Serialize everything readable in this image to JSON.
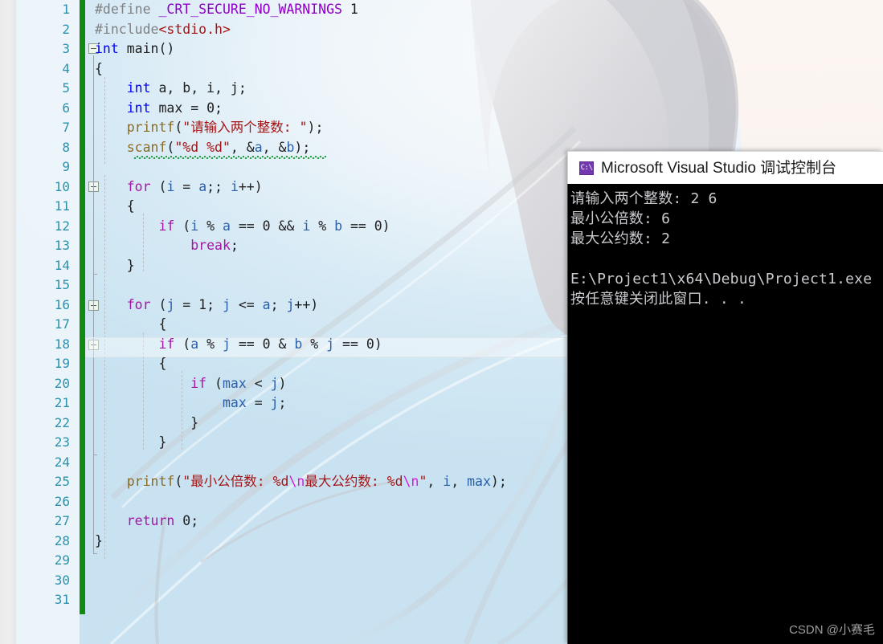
{
  "editor": {
    "name": "visual-studio-code-editor",
    "line_numbers": [
      1,
      2,
      3,
      4,
      5,
      6,
      7,
      8,
      9,
      10,
      11,
      12,
      13,
      14,
      15,
      16,
      17,
      18,
      19,
      20,
      21,
      22,
      23,
      24,
      25,
      26,
      27,
      28,
      29,
      30,
      31
    ],
    "current_line": 18,
    "change_bar_color": "#108a10",
    "gutter_number_color": "#2b91af",
    "lines": [
      {
        "n": 1,
        "text": "#define _CRT_SECURE_NO_WARNINGS 1"
      },
      {
        "n": 2,
        "text": "#include<stdio.h>"
      },
      {
        "n": 3,
        "text": "int main()"
      },
      {
        "n": 4,
        "text": "{"
      },
      {
        "n": 5,
        "text": "    int a, b, i, j;"
      },
      {
        "n": 6,
        "text": "    int max = 0;"
      },
      {
        "n": 7,
        "text": "    printf(\"请输入两个整数: \");"
      },
      {
        "n": 8,
        "text": "    scanf(\"%d %d\", &a, &b);"
      },
      {
        "n": 9,
        "text": ""
      },
      {
        "n": 10,
        "text": "    for (i = a;; i++)"
      },
      {
        "n": 11,
        "text": "    {"
      },
      {
        "n": 12,
        "text": "        if (i % a == 0 && i % b == 0)"
      },
      {
        "n": 13,
        "text": "            break;"
      },
      {
        "n": 14,
        "text": "    }"
      },
      {
        "n": 15,
        "text": ""
      },
      {
        "n": 16,
        "text": "    for (j = 1; j <= a; j++)"
      },
      {
        "n": 17,
        "text": "    {"
      },
      {
        "n": 18,
        "text": "        if (a % j == 0 & b % j == 0)"
      },
      {
        "n": 19,
        "text": "        {"
      },
      {
        "n": 20,
        "text": "            if (max < j)"
      },
      {
        "n": 21,
        "text": "                max = j;"
      },
      {
        "n": 22,
        "text": "        }"
      },
      {
        "n": 23,
        "text": "    }"
      },
      {
        "n": 24,
        "text": ""
      },
      {
        "n": 25,
        "text": "    printf(\"最小公倍数: %d\\n最大公约数: %d\\n\", i, max);"
      },
      {
        "n": 26,
        "text": ""
      },
      {
        "n": 27,
        "text": "    return 0;"
      },
      {
        "n": 28,
        "text": "}"
      },
      {
        "n": 29,
        "text": ""
      },
      {
        "n": 30,
        "text": ""
      },
      {
        "n": 31,
        "text": ""
      }
    ],
    "tokens": {
      "l1": [
        [
          "#define ",
          "t-pre"
        ],
        [
          "_CRT_SECURE_NO_WARNINGS",
          "t-macro"
        ],
        [
          " ",
          "t-plain"
        ],
        [
          "1",
          "t-num"
        ]
      ],
      "l2": [
        [
          "#include",
          "t-pre"
        ],
        [
          "<stdio.h>",
          "t-hdr"
        ]
      ],
      "l3": [
        [
          "int",
          "t-kw"
        ],
        [
          " main()",
          "t-plain"
        ]
      ],
      "l4": [
        [
          "{",
          "t-brace"
        ]
      ],
      "l5": [
        [
          "    ",
          "t-plain"
        ],
        [
          "int",
          "t-kw"
        ],
        [
          " a, b, i, j;",
          "t-plain"
        ]
      ],
      "l6": [
        [
          "    ",
          "t-plain"
        ],
        [
          "int",
          "t-kw"
        ],
        [
          " max = 0;",
          "t-plain"
        ]
      ],
      "l7": [
        [
          "    ",
          "t-plain"
        ],
        [
          "printf",
          "t-fn"
        ],
        [
          "(",
          "t-plain"
        ],
        [
          "\"请输入两个整数: \"",
          "t-str"
        ],
        [
          ");",
          "t-plain"
        ]
      ],
      "l8": [
        [
          "    ",
          "t-plain"
        ],
        [
          "scanf",
          "t-fn"
        ],
        [
          "(",
          "t-plain"
        ],
        [
          "\"%d %d\"",
          "t-str"
        ],
        [
          ", &",
          "t-plain"
        ],
        [
          "a",
          "t-id"
        ],
        [
          ", &",
          "t-plain"
        ],
        [
          "b",
          "t-id"
        ],
        [
          ");",
          "t-plain"
        ]
      ],
      "l10": [
        [
          "    ",
          "t-plain"
        ],
        [
          "for",
          "t-ctl"
        ],
        [
          " (",
          "t-plain"
        ],
        [
          "i",
          "t-id"
        ],
        [
          " = ",
          "t-plain"
        ],
        [
          "a",
          "t-id"
        ],
        [
          ";; ",
          "t-plain"
        ],
        [
          "i",
          "t-id"
        ],
        [
          "++)",
          "t-plain"
        ]
      ],
      "l11": [
        [
          "    {",
          "t-brace"
        ]
      ],
      "l12": [
        [
          "        ",
          "t-plain"
        ],
        [
          "if",
          "t-ctl"
        ],
        [
          " (",
          "t-plain"
        ],
        [
          "i",
          "t-id"
        ],
        [
          " % ",
          "t-plain"
        ],
        [
          "a",
          "t-id"
        ],
        [
          " == 0 && ",
          "t-plain"
        ],
        [
          "i",
          "t-id"
        ],
        [
          " % ",
          "t-plain"
        ],
        [
          "b",
          "t-id"
        ],
        [
          " == 0)",
          "t-plain"
        ]
      ],
      "l13": [
        [
          "            ",
          "t-plain"
        ],
        [
          "break",
          "t-ctl"
        ],
        [
          ";",
          "t-plain"
        ]
      ],
      "l14": [
        [
          "    }",
          "t-brace"
        ]
      ],
      "l16": [
        [
          "    ",
          "t-plain"
        ],
        [
          "for",
          "t-ctl"
        ],
        [
          " (",
          "t-plain"
        ],
        [
          "j",
          "t-id"
        ],
        [
          " = 1; ",
          "t-plain"
        ],
        [
          "j",
          "t-id"
        ],
        [
          " <= ",
          "t-plain"
        ],
        [
          "a",
          "t-id"
        ],
        [
          "; ",
          "t-plain"
        ],
        [
          "j",
          "t-id"
        ],
        [
          "++)",
          "t-plain"
        ]
      ],
      "l17": [
        [
          "        {",
          "t-brace"
        ]
      ],
      "l18": [
        [
          "        ",
          "t-plain"
        ],
        [
          "if",
          "t-ctl"
        ],
        [
          " (",
          "t-plain"
        ],
        [
          "a",
          "t-id"
        ],
        [
          " % ",
          "t-plain"
        ],
        [
          "j",
          "t-id"
        ],
        [
          " == 0 & ",
          "t-plain"
        ],
        [
          "b",
          "t-id"
        ],
        [
          " % ",
          "t-plain"
        ],
        [
          "j",
          "t-id"
        ],
        [
          " == 0)",
          "t-plain"
        ]
      ],
      "l19": [
        [
          "        {",
          "t-brace"
        ]
      ],
      "l20": [
        [
          "            ",
          "t-plain"
        ],
        [
          "if",
          "t-ctl"
        ],
        [
          " (",
          "t-plain"
        ],
        [
          "max",
          "t-id"
        ],
        [
          " < ",
          "t-plain"
        ],
        [
          "j",
          "t-id"
        ],
        [
          ")",
          "t-plain"
        ]
      ],
      "l21": [
        [
          "                ",
          "t-plain"
        ],
        [
          "max",
          "t-id"
        ],
        [
          " = ",
          "t-plain"
        ],
        [
          "j",
          "t-id"
        ],
        [
          ";",
          "t-plain"
        ]
      ],
      "l22": [
        [
          "            }",
          "t-brace"
        ]
      ],
      "l23": [
        [
          "        }",
          "t-brace"
        ]
      ],
      "l25": [
        [
          "    ",
          "t-plain"
        ],
        [
          "printf",
          "t-fn"
        ],
        [
          "(",
          "t-plain"
        ],
        [
          "\"最小公倍数: %d",
          "t-str"
        ],
        [
          "\\n",
          "t-esc"
        ],
        [
          "最大公约数: %d",
          "t-str"
        ],
        [
          "\\n",
          "t-esc"
        ],
        [
          "\"",
          "t-str"
        ],
        [
          ", ",
          "t-plain"
        ],
        [
          "i",
          "t-id"
        ],
        [
          ", ",
          "t-plain"
        ],
        [
          "max",
          "t-id"
        ],
        [
          ");",
          "t-plain"
        ]
      ],
      "l27": [
        [
          "    ",
          "t-plain"
        ],
        [
          "return",
          "t-ctl"
        ],
        [
          " 0;",
          "t-plain"
        ]
      ],
      "l28": [
        [
          "}",
          "t-brace"
        ]
      ]
    }
  },
  "console": {
    "window_title": "Microsoft Visual Studio 调试控制台",
    "icon_label": "C:\\",
    "output_lines": [
      "请输入两个整数: 2 6",
      "最小公倍数: 6",
      "最大公约数: 2",
      "",
      "E:\\Project1\\x64\\Debug\\Project1.exe",
      "按任意键关闭此窗口. . ."
    ],
    "background_color": "#000000",
    "text_color": "#ccccd0"
  },
  "watermark": {
    "text": "CSDN @小赛毛"
  }
}
